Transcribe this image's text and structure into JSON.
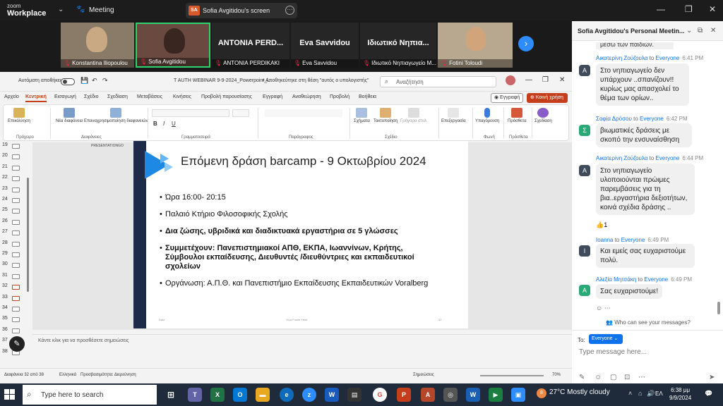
{
  "zoom": {
    "brand_top": "zoom",
    "brand_bottom": "Workplace",
    "meeting_label": "Meeting",
    "screen_share_initials": "SA",
    "screen_share_label": "Sofia Avgitidou's screen"
  },
  "participants": [
    {
      "name": "Konstantina Iliopoulou",
      "big": ""
    },
    {
      "name": "Sofia Avgitidou",
      "big": ""
    },
    {
      "name": "ANTONIA PERDIKAKI",
      "big": "ANTONIA PERD..."
    },
    {
      "name": "Eva Savvidou",
      "big": "Eva Savvidou"
    },
    {
      "name": "Ιδιωτικό Νηπιαγωγείο M...",
      "big": "Ιδιωτικό Νηπια..."
    },
    {
      "name": "Fotini Toloudi",
      "big": ""
    }
  ],
  "ppt": {
    "autosave_label": "Αυτόματη αποθήκευση",
    "file_title": "T AUTH WEBINAR 9-9-2024_Powerpoint_l...",
    "saved_status": "• Αποθηκεύτηκε στη θέση \"αυτός ο υπολογιστής\"",
    "search_placeholder": "Αναζήτηση",
    "tabs": [
      "Αρχείο",
      "Κεντρική",
      "Εισαγωγή",
      "Σχέδιο",
      "Σχεδίαση",
      "Μεταβάσεις",
      "Κινήσεις",
      "Προβολή παρουσίασης",
      "Εγγραφή",
      "Αναθεώρηση",
      "Προβολή",
      "Βοήθεια"
    ],
    "record_button": "◉ Εγγραφή",
    "share_button": "⊕ Κοινή χρήση",
    "ribbon": {
      "paste": "Επικόλληση",
      "new_slide": "Νέα διαφάνεια",
      "reuse": "Επαναχρησιμοποίηση διαφανειών",
      "shapes": "Σχήματα",
      "arrange": "Τακτοποίηση",
      "quick_styles": "Γρήγορα στυλ",
      "editing": "Επεξεργασία",
      "dictate": "Υπαγόρευση",
      "addins": "Πρόσθετα",
      "designer": "Σχεδίαση",
      "groups": [
        "Πρόχειρο",
        "Διαφάνειες",
        "Γραμματοσειρά",
        "Παράγραφος",
        "Σχέδιο",
        "Φωνή",
        "Πρόσθετα"
      ]
    },
    "thumb_numbers": [
      "19",
      "20",
      "21",
      "22",
      "23",
      "24",
      "25",
      "26",
      "27",
      "28",
      "29",
      "30",
      "31",
      "32",
      "33",
      "34",
      "35",
      "36",
      "37",
      "38"
    ],
    "slide": {
      "logo_text": "PRESENTATIONGO",
      "title": "Επόμενη δράση barcamp - 9 Οκτωβρίου 2024",
      "bullets": [
        {
          "text": "Ώρα 16:00- 20:15",
          "bold": false
        },
        {
          "text": "Παλαιό Κτήριο Φιλοσοφικής Σχολής",
          "bold": false
        },
        {
          "text": "Δια ζώσης, υβριδικά και διαδικτυακά εργαστήρια σε 5 γλώσσες",
          "bold": true
        },
        {
          "text": "Συμμετέχουν: Πανεπιστημιακοί ΑΠΘ, ΕΚΠΑ, Ιωαννίνων, Κρήτης, Σύμβουλοι εκπαίδευσης, Διευθυντές /διευθύντριες και εκπαιδευτικοί σχολείων",
          "bold": true
        },
        {
          "text": "Οργάνωση: Α.Π.Θ. και Πανεπιστήμιο Εκπαίδευσης Εκπαιδευτικών Voralberg",
          "bold": false
        }
      ],
      "footer_left": "Date",
      "footer_center": "Your Footer Here",
      "footer_page": "32"
    },
    "notes_placeholder": "Κάντε κλικ για να προσθέσετε σημειώσεις",
    "status_slide": "Διαφάνεια 32 από 38",
    "status_lang": "Ελληνικά",
    "status_access": "Προσβασιμότητα: Διερεύνηση",
    "status_notes": "Σημειώσεις",
    "zoom_level": "70%"
  },
  "chat": {
    "title": "Sofia Avgitidou's Personal Meetin...",
    "partial_top": "μέσω των παιδιών.",
    "messages": [
      {
        "sender": "Αικατερίνη Ζούζουλα",
        "to": "to",
        "recipient": "Everyone",
        "time": "6:41 PM",
        "initial": "A",
        "color": "#3f4a5a",
        "text": "Στο νηπιαγωγείο δεν υπάρχουν ..σπανίζουν!! κυρίως μας απασχολεί το θέμα των ορίων.."
      },
      {
        "sender": "Σοφία Δρόσου",
        "to": "to",
        "recipient": "Everyone",
        "time": "6:42 PM",
        "initial": "Σ",
        "color": "#2aa876",
        "text": "βιωματικές δράσεις με σκοπό την ενσυναίσθηση"
      },
      {
        "sender": "Αικατερίνη Ζούζουλα",
        "to": "to",
        "recipient": "Everyone",
        "time": "6:44 PM",
        "initial": "A",
        "color": "#3f4a5a",
        "text": "Στο νηπιαγωγείο υλοποιούνται πρώιμες παρεμβάσεις για τη βια..εργαστήρια δεξιοτήτων, κοινά σχέδια δράσης .."
      },
      {
        "sender": "Ioanna",
        "to": "to",
        "recipient": "Everyone",
        "time": "6:49 PM",
        "initial": "I",
        "color": "#3f4a5a",
        "text": "Και εμείς σας ευχαριστούμε πολύ."
      },
      {
        "sender": "Αλεξία Μητσάκη",
        "to": "to",
        "recipient": "Everyone",
        "time": "6:49 PM",
        "initial": "A",
        "color": "#2aa876",
        "text": "Σας ευχαριστούμε!"
      }
    ],
    "reaction": "👍1",
    "who_can_see": "Who can see your messages?",
    "to_label": "To:",
    "to_value": "Everyone",
    "input_placeholder": "Type message here..."
  },
  "taskbar": {
    "search_placeholder": "Type here to search",
    "weather_badge": "8",
    "weather": "27°C  Mostly cloudy",
    "lang": "ΕΛ",
    "time": "6:38 μμ",
    "date": "9/9/2024"
  },
  "colors": {
    "ppt_accent": "#c43e1c",
    "zoom_blue": "#2d8cff",
    "chat_link": "#0e72ed",
    "slide_bar": "#1d2a4a"
  }
}
